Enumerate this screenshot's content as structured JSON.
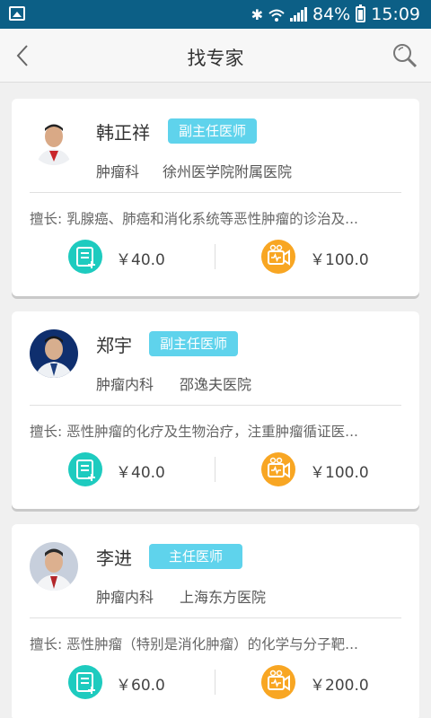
{
  "status_bar": {
    "battery_percent": "84%",
    "time": "15:09"
  },
  "header": {
    "title": "找专家"
  },
  "doctors": [
    {
      "name": "韩正祥",
      "title": "副主任医师",
      "department": "肿瘤科",
      "hospital": "徐州医学院附属医院",
      "specialty": "擅长: 乳腺癌、肺癌和消化系统等恶性肿瘤的诊治及...",
      "text_consult_price": "￥40.0",
      "video_consult_price": "￥100.0"
    },
    {
      "name": "郑宇",
      "title": "副主任医师",
      "department": "肿瘤内科",
      "hospital": "邵逸夫医院",
      "specialty": "擅长: 恶性肿瘤的化疗及生物治疗，注重肿瘤循证医...",
      "text_consult_price": "￥40.0",
      "video_consult_price": "￥100.0"
    },
    {
      "name": "李进",
      "title": "主任医师",
      "department": "肿瘤内科",
      "hospital": "上海东方医院",
      "specialty": "擅长: 恶性肿瘤（特别是消化肿瘤）的化学与分子靶...",
      "text_consult_price": "￥60.0",
      "video_consult_price": "￥200.0"
    }
  ],
  "colors": {
    "status_bar": "#0c5f86",
    "badge": "#5fd3ec",
    "text_consult_icon": "#1ecbbf",
    "video_consult_icon": "#f8a623"
  },
  "icons": {
    "back": "chevron-left-icon",
    "search": "search-icon",
    "text_consult": "text-consult-icon",
    "video_consult": "video-consult-icon"
  }
}
